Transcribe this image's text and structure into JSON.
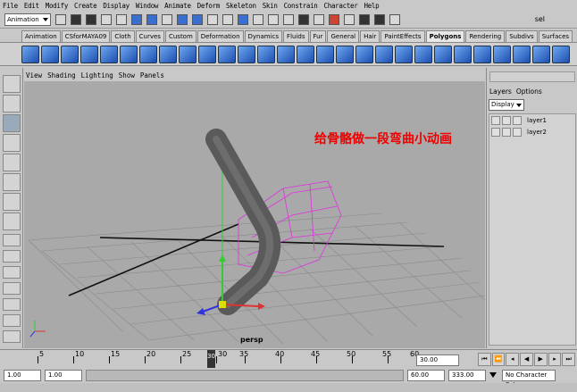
{
  "menubar": {
    "items": [
      "File",
      "Edit",
      "Modify",
      "Create",
      "Display",
      "Window",
      "Animate",
      "Deform",
      "Skeleton",
      "Skin",
      "Constrain",
      "Character",
      "Help"
    ]
  },
  "statusline": {
    "mode": "Animation",
    "sel_label": "sel"
  },
  "shelf": {
    "tabs": [
      "Animation",
      "CSforMAYA09",
      "Cloth",
      "Curves",
      "Custom",
      "Deformation",
      "Dynamics",
      "Fluids",
      "Fur",
      "General",
      "Hair",
      "PaintEffects",
      "Polygons",
      "Rendering",
      "Subdivs",
      "Surfaces"
    ],
    "active": "Polygons"
  },
  "panel": {
    "menu": [
      "View",
      "Shading",
      "Lighting",
      "Show",
      "Panels"
    ],
    "caption": "给骨骼做一段弯曲小动画",
    "camera": "persp"
  },
  "layers": {
    "menu": [
      "Layers",
      "Options"
    ],
    "display_mode": "Display",
    "items": [
      "layer1",
      "layer2"
    ]
  },
  "timeline": {
    "tick_labels": [
      "5",
      "10",
      "15",
      "20",
      "25",
      "30",
      "35",
      "40",
      "45",
      "50",
      "55"
    ],
    "current_frame": "30",
    "end_label": "60",
    "current_time_field": "30.00"
  },
  "range": {
    "start_time": "1.00",
    "start_range": "1.00",
    "end_range": "60.00",
    "end_time": "333.00",
    "character_set": "No Character Set"
  }
}
